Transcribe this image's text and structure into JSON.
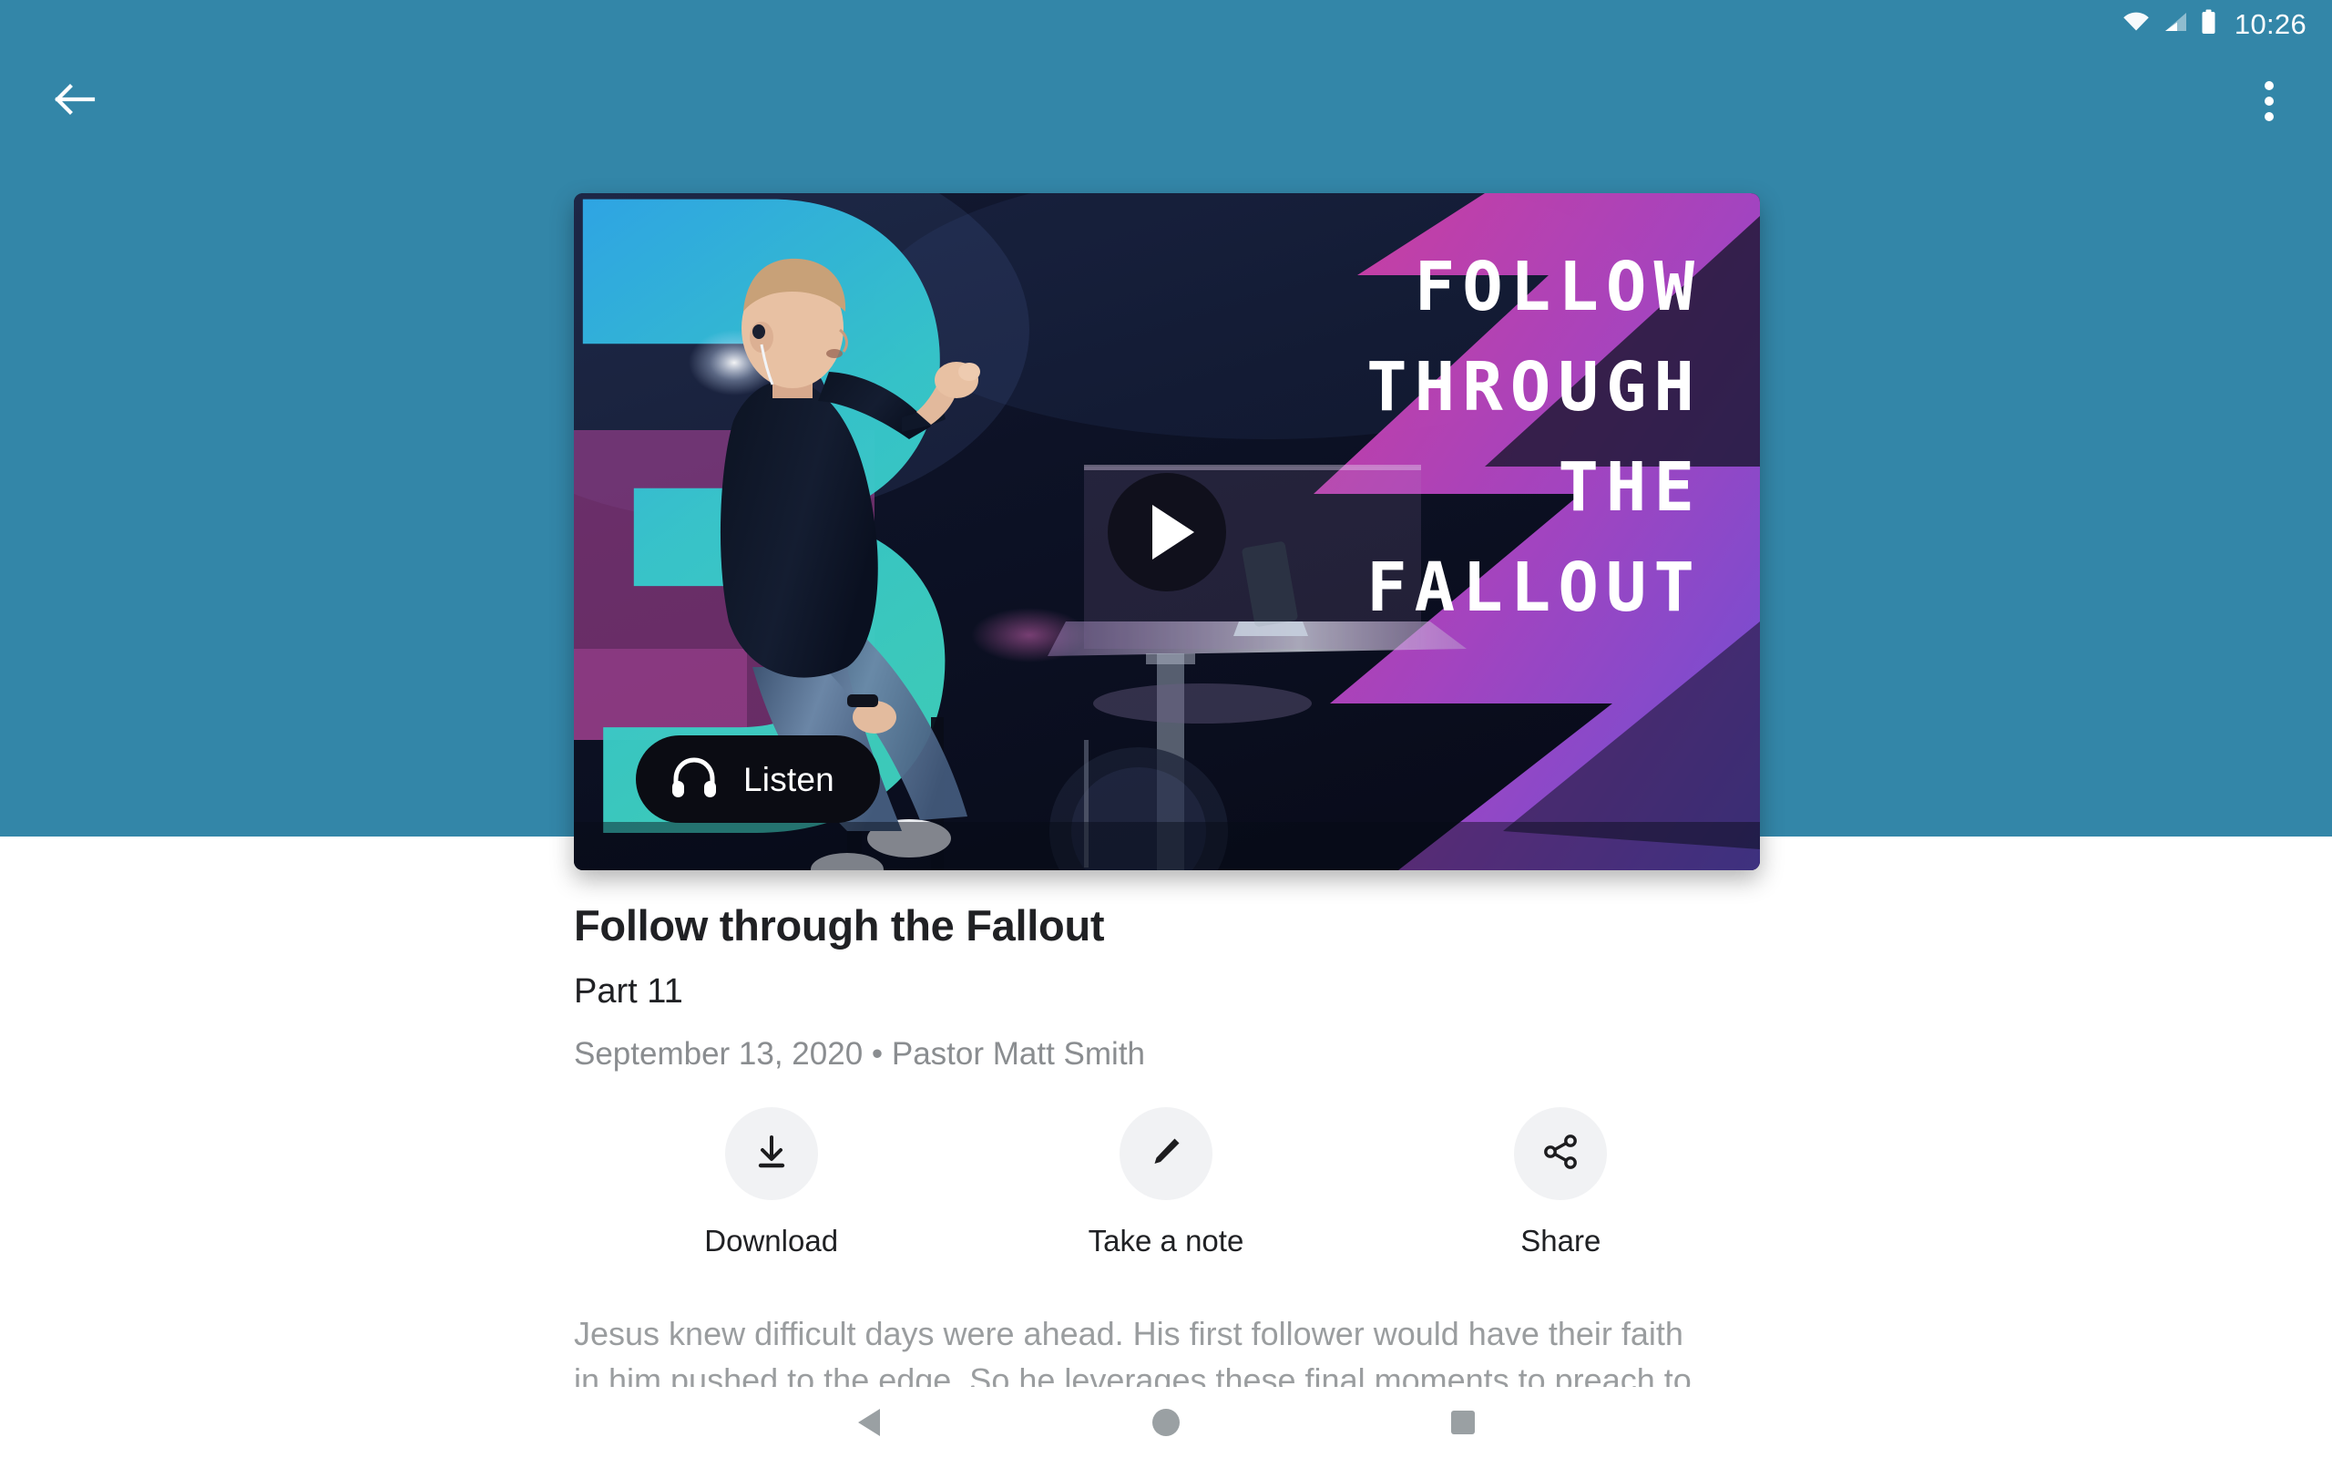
{
  "status_bar": {
    "clock": "10:26",
    "icons": [
      "wifi-icon",
      "cell-signal-icon",
      "battery-icon"
    ]
  },
  "app_bar": {
    "back_icon": "back-arrow-icon",
    "overflow_icon": "overflow-menu-icon"
  },
  "video": {
    "play_icon": "play-icon",
    "listen_label": "Listen",
    "listen_icon": "headphones-icon",
    "artwork_text_lines": [
      "FOLLOW",
      "THROUGH",
      "THE",
      "FALLOUT"
    ],
    "artwork_colors": {
      "teal_mark": "#34c6cd",
      "magenta": "#c13fa6",
      "purple": "#7a4fd6",
      "dark": "#101326"
    }
  },
  "details": {
    "title": "Follow through the Fallout",
    "subtitle": "Part 11",
    "meta": "September 13, 2020 • Pastor Matt Smith",
    "description": "Jesus knew difficult days were ahead. His first follower would have their faith in him pushed to the edge. So he leverages these final moments to preach to them and pray"
  },
  "actions": [
    {
      "label": "Download",
      "icon": "download-icon"
    },
    {
      "label": "Take a note",
      "icon": "pencil-icon"
    },
    {
      "label": "Share",
      "icon": "share-icon"
    }
  ],
  "nav_bar": {
    "back": "nav-back-icon",
    "home": "nav-home-icon",
    "recents": "nav-recents-icon"
  },
  "colors": {
    "accent_teal": "#3386a8",
    "text_primary": "#202124",
    "text_secondary": "#8a8d90",
    "chip_bg": "#f1f2f4"
  }
}
